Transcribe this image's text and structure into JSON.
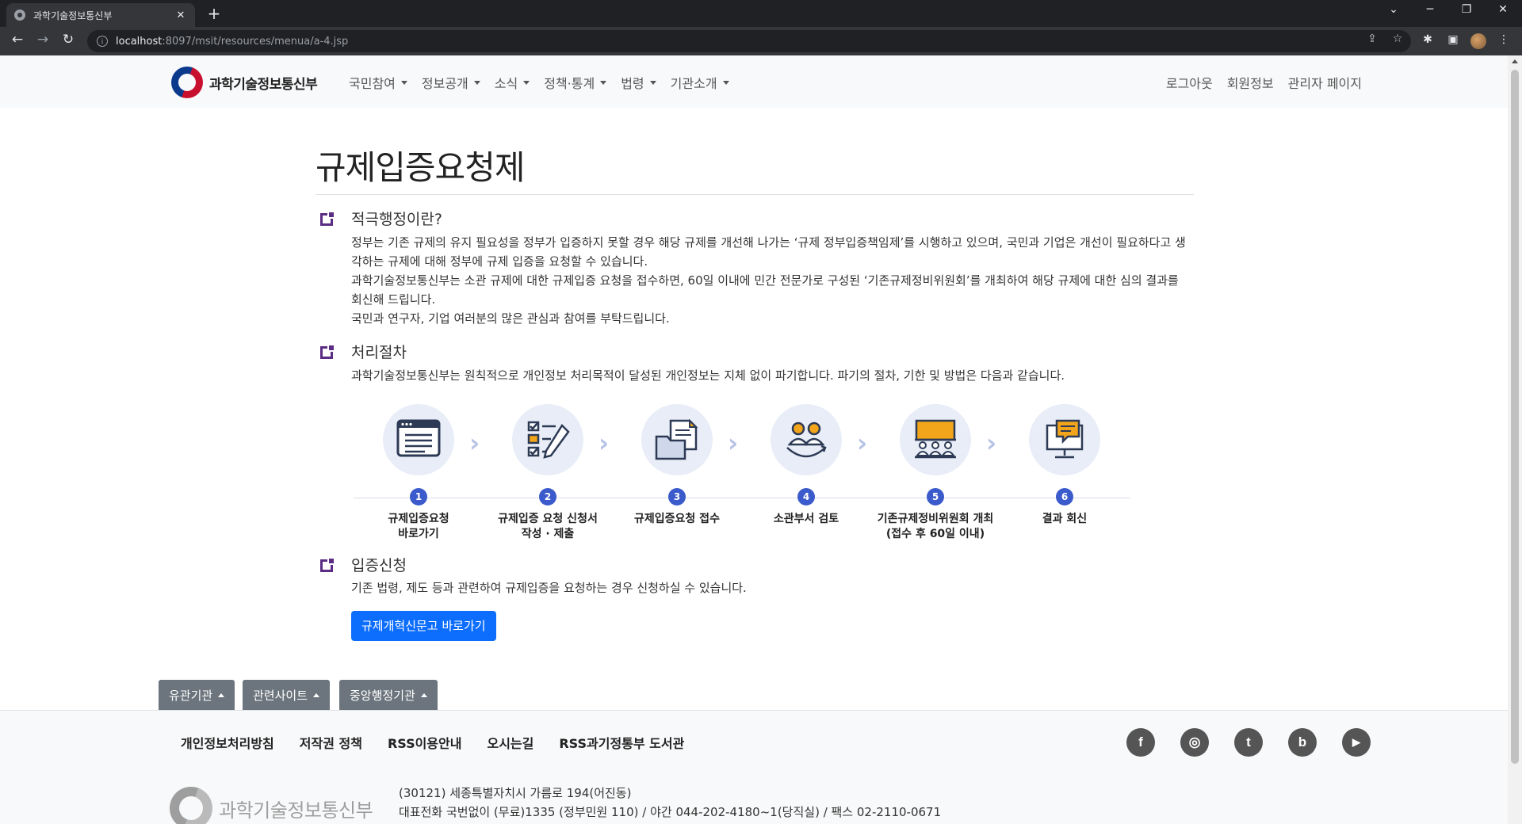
{
  "browser": {
    "tab_title": "과학기술정보통신부",
    "url_host": "localhost",
    "url_rest": ":8097/msit/resources/menua/a-4.jsp",
    "new_tab": "+",
    "tab_close": "✕"
  },
  "header": {
    "logo_text": "과학기술정보통신부",
    "nav": [
      "국민참여",
      "정보공개",
      "소식",
      "정책·통계",
      "법령",
      "기관소개"
    ],
    "user_links": [
      "로그아웃",
      "회원정보",
      "관리자 페이지"
    ]
  },
  "page": {
    "title": "규제입증요청제",
    "sections": [
      {
        "title": "적극행정이란?",
        "paragraphs": [
          "정부는 기존 규제의 유지 필요성을 정부가 입증하지 못할 경우 해당 규제를 개선해 나가는 ‘규제 정부입증책임제’를 시행하고 있으며, 국민과 기업은 개선이 필요하다고 생각하는 규제에 대해 정부에 규제 입증을 요청할 수 있습니다.",
          "과학기술정보통신부는 소관 규제에 대한 규제입증 요청을 접수하면, 60일 이내에 민간 전문가로 구성된 ‘기존규제정비위원회’를 개최하여 해당 규제에 대한 심의 결과를 회신해 드립니다.",
          "국민과 연구자, 기업 여러분의 많은 관심과 참여를 부탁드립니다."
        ]
      },
      {
        "title": "처리절차",
        "paragraphs": [
          "과학기술정보통신부는 원칙적으로 개인정보 처리목적이 달성된 개인정보는 지체 없이 파기합니다. 파기의 절차, 기한 및 방법은 다음과 같습니다."
        ]
      },
      {
        "title": "입증신청",
        "paragraphs": [
          "기존 법령, 제도 등과 관련하여 규제입증을 요청하는 경우 신청하실 수 있습니다."
        ]
      }
    ],
    "steps": [
      {
        "num": "1",
        "line1": "규제입증요청",
        "line2": "바로가기",
        "icon": "form-list-icon"
      },
      {
        "num": "2",
        "line1": "규제입증 요청 신청서",
        "line2": "작성 · 제출",
        "icon": "checklist-pen-icon"
      },
      {
        "num": "3",
        "line1": "규제입증요청 접수",
        "line2": "",
        "icon": "document-folder-icon"
      },
      {
        "num": "4",
        "line1": "소관부서 검토",
        "line2": "",
        "icon": "people-review-icon"
      },
      {
        "num": "5",
        "line1": "기존규제정비위원회 개최",
        "line2": "(접수 후 60일 이내)",
        "icon": "committee-board-icon"
      },
      {
        "num": "6",
        "line1": "결과 회신",
        "line2": "",
        "icon": "reply-monitor-icon"
      }
    ],
    "cta_label": "규제개혁신문고 바로가기"
  },
  "footer": {
    "dropdowns": [
      "유관기관",
      "관련사이트",
      "중앙행정기관"
    ],
    "links": [
      "개인정보처리방침",
      "저작권 정책",
      "RSS이용안내",
      "오시는길",
      "RSS과기정통부 도서관"
    ],
    "social": [
      {
        "name": "facebook-icon",
        "glyph": "f"
      },
      {
        "name": "instagram-icon",
        "glyph": "◎"
      },
      {
        "name": "twitter-icon",
        "glyph": "t"
      },
      {
        "name": "blog-icon",
        "glyph": "b"
      },
      {
        "name": "youtube-icon",
        "glyph": "▶"
      }
    ],
    "logo_text": "과학기술정보통신부",
    "address": "(30121) 세종특별자치시 가름로 194(어진동)",
    "phone": "대표전화 국번없이 (무료)1335 (정부민원 110) / 야간 044-202-4180~1(당직실) / 팩스 02-2110-0671"
  },
  "colors": {
    "accent": "#5b2c83",
    "primary_button": "#0d6efd",
    "step_number": "#3b5bcc",
    "footer_dropdown": "#6c757d"
  }
}
